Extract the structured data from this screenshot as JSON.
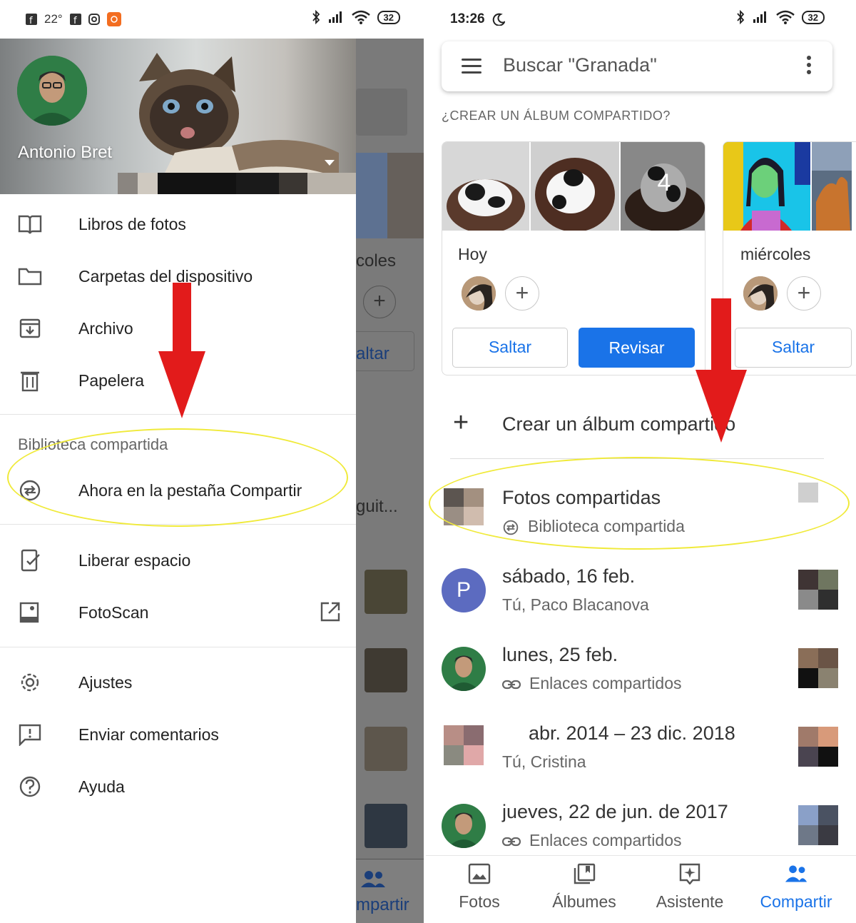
{
  "left": {
    "status": {
      "temp": "22°",
      "battery": "32"
    },
    "drawer": {
      "username": "Antonio Bret",
      "items_top": [
        {
          "label": "Libros de fotos",
          "icon": "book-icon"
        },
        {
          "label": "Carpetas del dispositivo",
          "icon": "folder-icon"
        },
        {
          "label": "Archivo",
          "icon": "archive-icon"
        },
        {
          "label": "Papelera",
          "icon": "trash-icon"
        }
      ],
      "section_label": "Biblioteca compartida",
      "shared_item": {
        "label": "Ahora en la pestaña Compartir",
        "icon": "shared-library-icon"
      },
      "items_mid": [
        {
          "label": "Liberar espacio",
          "icon": "free-space-icon"
        },
        {
          "label": "FotoScan",
          "icon": "photoscan-icon"
        }
      ],
      "items_bottom": [
        {
          "label": "Ajustes",
          "icon": "settings-icon"
        },
        {
          "label": "Enviar comentarios",
          "icon": "feedback-icon"
        },
        {
          "label": "Ayuda",
          "icon": "help-icon"
        }
      ]
    },
    "background_app": {
      "text1": "coles",
      "text2": "altar",
      "text3": "guit...",
      "nav": "mpartir",
      "plus": "+"
    }
  },
  "right": {
    "status": {
      "time": "13:26",
      "battery": "32"
    },
    "search": {
      "placeholder": "Buscar \"Granada\""
    },
    "suggest_header": "¿CREAR UN ÁLBUM COMPARTIDO?",
    "cards": [
      {
        "date": "Hoy",
        "count": "4",
        "skip": "Saltar",
        "review": "Revisar"
      },
      {
        "date": "miércoles",
        "skip": "Saltar"
      }
    ],
    "create_label": "Crear un álbum compartido",
    "rows": [
      {
        "title": "Fotos compartidas",
        "subtitle": "Biblioteca compartida"
      },
      {
        "avatar_letter": "P",
        "title": "sábado, 16 feb.",
        "subtitle": "Tú, Paco Blacanova"
      },
      {
        "title": "lunes, 25 feb.",
        "subtitle": "Enlaces compartidos"
      },
      {
        "title": "abr. 2014 – 23 dic. 2018",
        "subtitle": "Tú, Cristina"
      },
      {
        "title": "jueves, 22 de jun. de 2017",
        "subtitle": "Enlaces compartidos"
      }
    ],
    "nav": [
      {
        "label": "Fotos",
        "icon": "photo-icon"
      },
      {
        "label": "Álbumes",
        "icon": "albums-icon"
      },
      {
        "label": "Asistente",
        "icon": "assistant-icon"
      },
      {
        "label": "Compartir",
        "icon": "share-people-icon",
        "active": true
      }
    ],
    "accent": "#1a73e8"
  },
  "annotation_color": "#e21b1b",
  "highlight_color": "#f0ea3a"
}
